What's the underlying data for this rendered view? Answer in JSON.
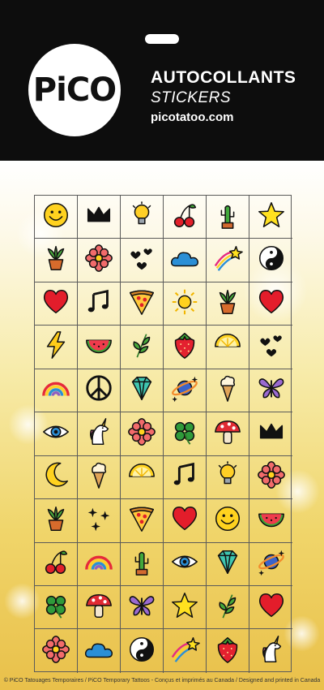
{
  "header": {
    "logo_text": "PiCO",
    "title": "AUTOCOLLANTS",
    "subtitle": "STICKERS",
    "url": "picotatoo.com"
  },
  "colors": {
    "header_bg": "#0d0d0d",
    "sheet_top": "#ffffff",
    "sheet_bottom": "#e9c04a",
    "grid_line": "#5a5a5a"
  },
  "sticker_grid": [
    [
      "smiley-icon",
      "crown-icon",
      "lightbulb-icon",
      "cherries-icon",
      "cactus-icon",
      "star-icon"
    ],
    [
      "potted-plant-icon",
      "flower-icon",
      "hearts-icon",
      "cloud-icon",
      "shooting-star-icon",
      "yin-yang-icon"
    ],
    [
      "heart-icon",
      "music-note-icon",
      "pizza-icon",
      "sun-icon",
      "potted-plant-icon",
      "heart-icon"
    ],
    [
      "lightning-icon",
      "watermelon-icon",
      "leaf-icon",
      "strawberry-icon",
      "lemon-icon",
      "hearts-icon"
    ],
    [
      "rainbow-icon",
      "peace-icon",
      "diamond-icon",
      "planet-icon",
      "ice-cream-icon",
      "butterfly-icon"
    ],
    [
      "eye-icon",
      "unicorn-icon",
      "flower-icon",
      "clover-icon",
      "mushroom-icon",
      "crown-icon"
    ],
    [
      "moon-icon",
      "ice-cream-icon",
      "lemon-icon",
      "music-note-icon",
      "lightbulb-icon",
      "flower-icon"
    ],
    [
      "potted-plant-icon",
      "sparkles-icon",
      "pizza-icon",
      "heart-icon",
      "smiley-icon",
      "watermelon-icon"
    ],
    [
      "cherries-icon",
      "rainbow-icon",
      "cactus-icon",
      "eye-icon",
      "diamond-icon",
      "planet-icon"
    ],
    [
      "clover-icon",
      "mushroom-icon",
      "butterfly-icon",
      "star-icon",
      "leaf-icon",
      "heart-icon"
    ],
    [
      "flower-icon",
      "cloud-icon",
      "yin-yang-icon",
      "shooting-star-icon",
      "strawberry-icon",
      "unicorn-icon"
    ]
  ],
  "footer": {
    "text": "© PiCO Tatouages Temporaires / PiCO Temporary Tattoos - Conçus et imprimés au Canada / Designed and printed in Canada"
  }
}
